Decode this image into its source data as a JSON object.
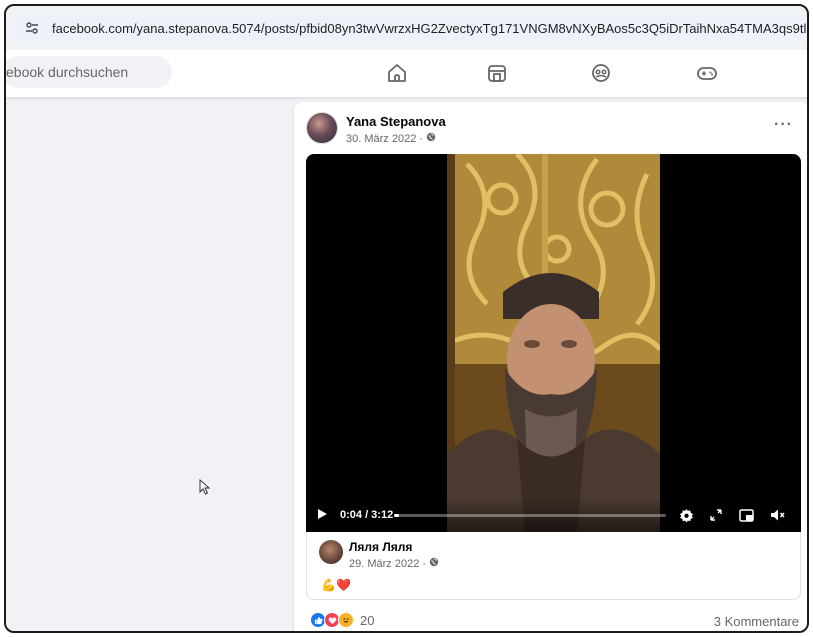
{
  "browser": {
    "url": "facebook.com/yana.stepanova.5074/posts/pfbid08yn3twVwrzxHG2ZvectyxTg171VNGM8vNXyBAos5c3Q5iDrTaihNxa54TMA3qs9tl"
  },
  "nav": {
    "search_placeholder": "ebook durchsuchen",
    "icons": [
      "home-icon",
      "marketplace-icon",
      "groups-icon",
      "gaming-icon"
    ]
  },
  "post": {
    "author": "Yana Stepanova",
    "date": "30. März 2022 · ",
    "more_label": "···",
    "video": {
      "time": "0:04 / 3:12",
      "progress": 0.02
    },
    "shared": {
      "name": "Ляля Ляля",
      "date": "29. März 2022 · ",
      "emoji": "💪❤️"
    },
    "reaction_count": "20",
    "comments_label": "3 Kommentare"
  },
  "colors": {
    "accent": "#1877f2",
    "love": "#f33e58",
    "haha": "#f7b125"
  }
}
